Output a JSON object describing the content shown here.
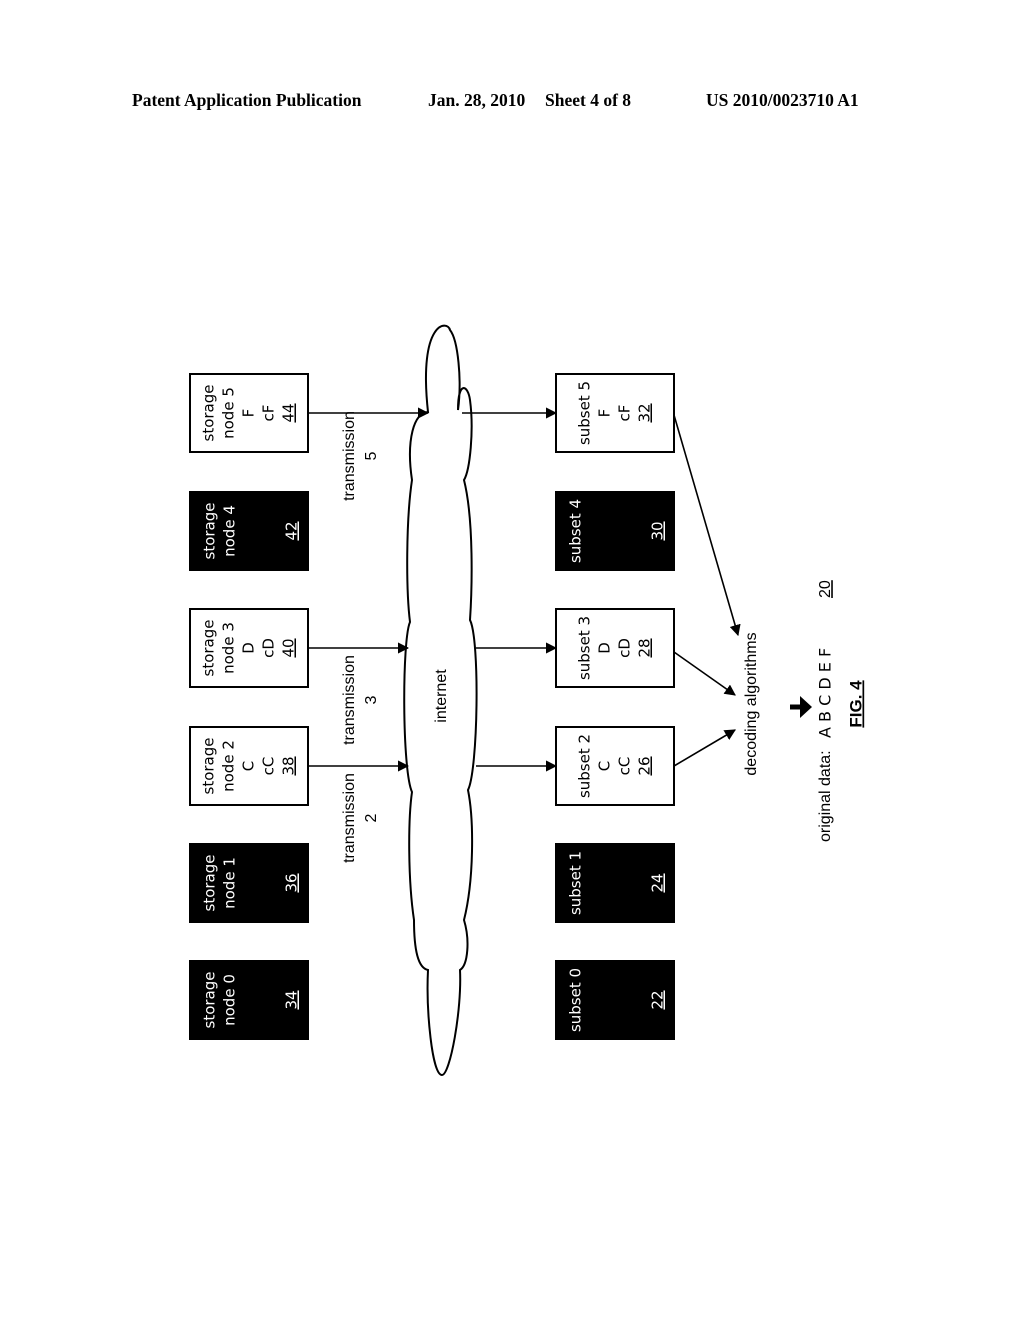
{
  "header": {
    "publication": "Patent Application Publication",
    "date": "Jan. 28, 2010",
    "sheet": "Sheet 4 of 8",
    "number": "US 2010/0023710 A1"
  },
  "storage_nodes": [
    {
      "lines": [
        "storage",
        "node 0"
      ],
      "ref": "34",
      "available": false
    },
    {
      "lines": [
        "storage",
        "node 1"
      ],
      "ref": "36",
      "available": false
    },
    {
      "lines": [
        "storage",
        "node 2",
        "C",
        "cC"
      ],
      "ref": "38",
      "available": true
    },
    {
      "lines": [
        "storage",
        "node 3",
        "D",
        "cD"
      ],
      "ref": "40",
      "available": true
    },
    {
      "lines": [
        "storage",
        "node 4"
      ],
      "ref": "42",
      "available": false
    },
    {
      "lines": [
        "storage",
        "node 5",
        "F",
        "cF"
      ],
      "ref": "44",
      "available": true
    }
  ],
  "subsets": [
    {
      "lines": [
        "subset 0"
      ],
      "ref": "22",
      "available": false
    },
    {
      "lines": [
        "subset 1"
      ],
      "ref": "24",
      "available": false
    },
    {
      "lines": [
        "subset 2",
        "C",
        "cC"
      ],
      "ref": "26",
      "available": true
    },
    {
      "lines": [
        "subset 3",
        "D",
        "cD"
      ],
      "ref": "28",
      "available": true
    },
    {
      "lines": [
        "subset 4"
      ],
      "ref": "30",
      "available": false
    },
    {
      "lines": [
        "subset 5",
        "F",
        "cF"
      ],
      "ref": "32",
      "available": true
    }
  ],
  "transmissions": [
    {
      "lines": [
        "transmission",
        "2"
      ]
    },
    {
      "lines": [
        "transmission",
        "3"
      ]
    },
    {
      "lines": [
        "transmission",
        "5"
      ]
    }
  ],
  "cloud_label": "internet",
  "decoder_label": "decoding algorithms",
  "original_data": {
    "label": "original data:",
    "letters": "A  B  C  D  E  F",
    "ref": "20"
  },
  "figure_label": "FIG. 4",
  "colors": {
    "ink": "#000000",
    "paper": "#ffffff"
  }
}
